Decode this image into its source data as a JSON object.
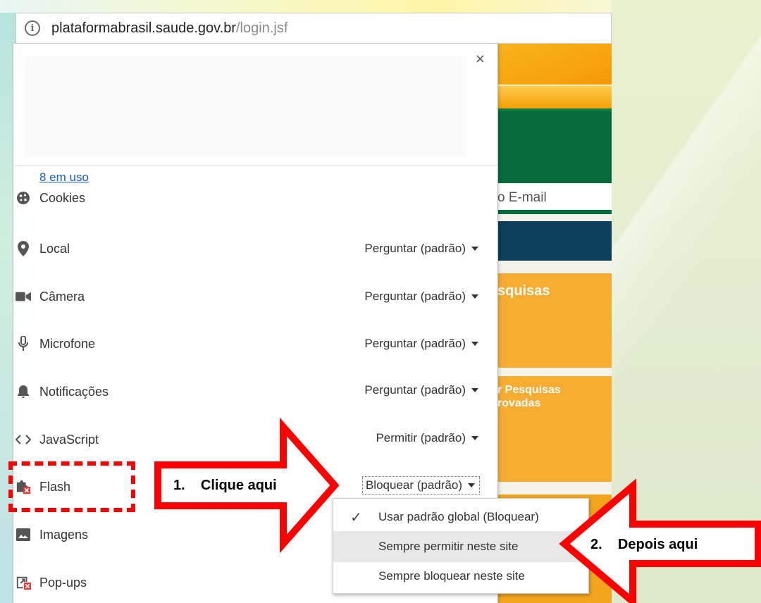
{
  "browser": {
    "address_bar": {
      "host": "plataformabrasil.saude.gov.br",
      "path": "/login.jsf",
      "info_icon": "info-icon"
    }
  },
  "background_page": {
    "email_fragment": "o E-mail",
    "box1_title": "squisas",
    "box2_line1": "r Pesquisas",
    "box2_line2": "rovadas"
  },
  "site_info_popup": {
    "close_label": "×",
    "cookies": {
      "label": "Cookies",
      "sub_link": "8 em uso",
      "icon": "cookie-icon"
    },
    "permissions": [
      {
        "key": "local",
        "label": "Local",
        "icon": "location-icon",
        "value": "Perguntar (padrão)"
      },
      {
        "key": "camera",
        "label": "Câmera",
        "icon": "camera-icon",
        "value": "Perguntar (padrão)"
      },
      {
        "key": "microfone",
        "label": "Microfone",
        "icon": "microphone-icon",
        "value": "Perguntar (padrão)"
      },
      {
        "key": "notificacoes",
        "label": "Notificações",
        "icon": "bell-icon",
        "value": "Perguntar (padrão)"
      },
      {
        "key": "javascript",
        "label": "JavaScript",
        "icon": "code-icon",
        "value": "Permitir (padrão)"
      },
      {
        "key": "flash",
        "label": "Flash",
        "icon": "plugin-blocked-icon",
        "value": "Bloquear (padrão)"
      },
      {
        "key": "imagens",
        "label": "Imagens",
        "icon": "image-icon"
      },
      {
        "key": "popups",
        "label": "Pop-ups",
        "icon": "popup-blocked-icon"
      }
    ]
  },
  "flash_dropdown": {
    "options": [
      {
        "label": "Usar padrão global (Bloquear)",
        "checked": true
      },
      {
        "label": "Sempre permitir neste site",
        "highlighted": true
      },
      {
        "label": "Sempre bloquear neste site"
      }
    ]
  },
  "annotations": {
    "step1": "1.    Clique aqui",
    "step2": "2.    Depois aqui",
    "highlight_color": "#ff0000"
  }
}
